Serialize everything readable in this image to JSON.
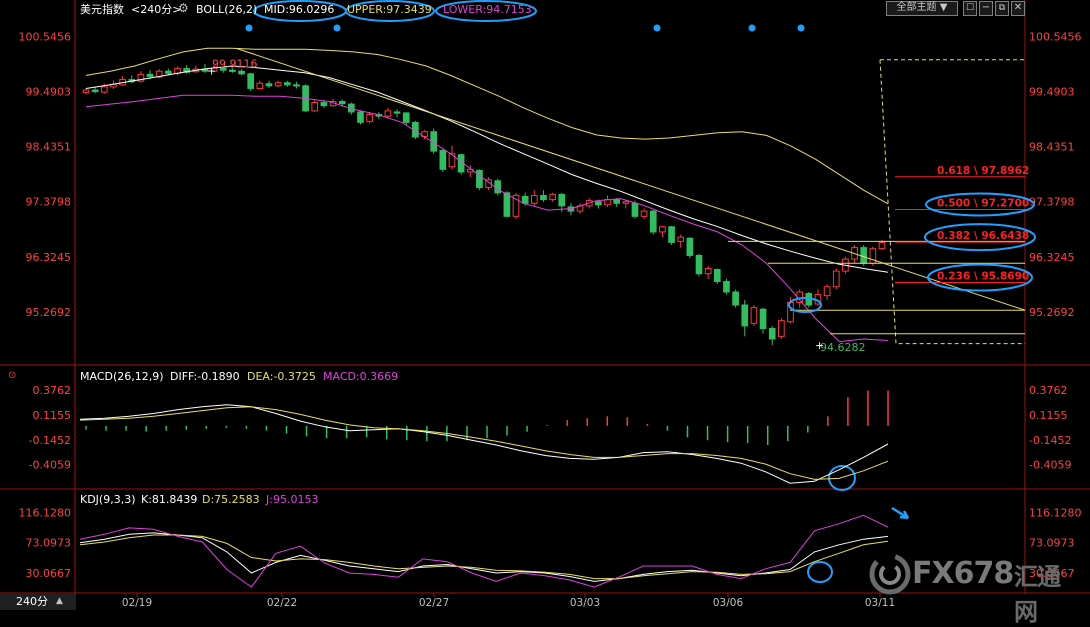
{
  "colors": {
    "up": "#ff3838",
    "down": "#2fbf5f",
    "mid": "#ffffff",
    "upper": "#e8e060",
    "lower": "#e040e0",
    "price_axis": "#ff4040",
    "fib": "#ff2020",
    "highlight": "#1ea0ff"
  },
  "header": {
    "symbol": "美元指数",
    "period": "<240分>",
    "indicator": "BOLL(26,2)",
    "mid": "MID:96.0296",
    "upper": "UPPER:97.3439",
    "lower": "LOWER:94.7153"
  },
  "toolbar": {
    "theme": "全部主题",
    "theme_arrow": "▼",
    "period_label": "240分",
    "period_arrow": "▲"
  },
  "chart_data": [
    {
      "type": "candlestick",
      "title": "美元指数 240分",
      "indicator": "BOLL(26,2)",
      "ylim": [
        94.5,
        100.9
      ],
      "price_ticks": [
        "100.5456",
        "99.4903",
        "98.4351",
        "97.3798",
        "96.3245",
        "95.2692"
      ],
      "date_ticks": [
        "02/19",
        "02/22",
        "02/27",
        "03/03",
        "03/06",
        "03/11"
      ],
      "high_label": "99.9116",
      "low_label": "94.6282",
      "fibonacci": [
        {
          "ratio": "0.618",
          "price": "97.8962"
        },
        {
          "ratio": "0.500",
          "price": "97.2700"
        },
        {
          "ratio": "0.382",
          "price": "96.6438"
        },
        {
          "ratio": "0.236",
          "price": "95.8690"
        }
      ],
      "series": [
        {
          "name": "MID",
          "values": [
            99.55,
            99.62,
            99.7,
            99.78,
            99.86,
            99.93,
            99.98,
            99.95,
            99.9,
            99.85,
            99.76,
            99.62,
            99.48,
            99.3,
            99.12,
            98.93,
            98.72,
            98.5,
            98.3,
            98.1,
            97.9,
            97.73,
            97.58,
            97.4,
            97.22,
            97.05,
            96.9,
            96.73,
            96.57,
            96.43,
            96.3,
            96.18,
            96.1,
            96.03
          ]
        },
        {
          "name": "UPPER",
          "values": [
            99.8,
            99.88,
            99.98,
            100.12,
            100.25,
            100.32,
            100.32,
            100.3,
            100.3,
            100.3,
            100.28,
            100.25,
            100.2,
            100.1,
            99.98,
            99.8,
            99.6,
            99.4,
            99.18,
            98.98,
            98.8,
            98.66,
            98.6,
            98.58,
            98.6,
            98.65,
            98.7,
            98.72,
            98.65,
            98.45,
            98.2,
            97.9,
            97.6,
            97.34
          ]
        },
        {
          "name": "LOWER",
          "values": [
            99.2,
            99.25,
            99.3,
            99.36,
            99.42,
            99.42,
            99.42,
            99.4,
            99.4,
            99.36,
            99.3,
            99.15,
            99.05,
            98.9,
            98.6,
            98.3,
            97.95,
            97.6,
            97.35,
            97.22,
            97.25,
            97.4,
            97.44,
            97.3,
            97.12,
            96.95,
            96.8,
            96.55,
            96.2,
            95.7,
            95.15,
            94.7,
            94.75,
            94.72
          ]
        }
      ],
      "candles": [
        [
          99.47,
          99.52,
          99.44,
          99.56
        ],
        [
          99.52,
          99.49,
          99.46,
          99.58
        ],
        [
          99.48,
          99.58,
          99.45,
          99.64
        ],
        [
          99.58,
          99.63,
          99.54,
          99.7
        ],
        [
          99.62,
          99.72,
          99.6,
          99.79
        ],
        [
          99.72,
          99.68,
          99.65,
          99.8
        ],
        [
          99.69,
          99.82,
          99.66,
          99.88
        ],
        [
          99.82,
          99.78,
          99.73,
          99.9
        ],
        [
          99.77,
          99.88,
          99.74,
          99.92
        ],
        [
          99.88,
          99.84,
          99.8,
          99.93
        ],
        [
          99.84,
          99.93,
          99.8,
          99.97
        ],
        [
          99.93,
          99.86,
          99.83,
          100.0
        ],
        [
          99.87,
          99.92,
          99.85,
          99.99
        ],
        [
          99.92,
          99.88,
          99.85,
          100.02
        ],
        [
          99.88,
          99.94,
          99.86,
          100.0
        ],
        [
          99.94,
          99.9,
          99.85,
          99.96
        ],
        [
          99.9,
          99.88,
          99.85,
          99.94
        ],
        [
          99.88,
          99.83,
          99.8,
          99.92
        ],
        [
          99.83,
          99.55,
          99.5,
          99.85
        ],
        [
          99.55,
          99.65,
          99.53,
          99.7
        ],
        [
          99.64,
          99.6,
          99.56,
          99.7
        ],
        [
          99.6,
          99.66,
          99.57,
          99.7
        ],
        [
          99.66,
          99.62,
          99.58,
          99.7
        ],
        [
          99.62,
          99.6,
          99.55,
          99.68
        ],
        [
          99.6,
          99.12,
          99.1,
          99.63
        ],
        [
          99.12,
          99.28,
          99.1,
          99.32
        ],
        [
          99.28,
          99.22,
          99.18,
          99.33
        ],
        [
          99.22,
          99.3,
          99.2,
          99.35
        ],
        [
          99.3,
          99.26,
          99.2,
          99.34
        ],
        [
          99.25,
          99.1,
          99.05,
          99.28
        ],
        [
          99.1,
          98.9,
          98.86,
          99.12
        ],
        [
          98.92,
          99.05,
          98.88,
          99.1
        ],
        [
          99.05,
          99.02,
          98.97,
          99.1
        ],
        [
          99.02,
          99.12,
          98.98,
          99.18
        ],
        [
          99.1,
          99.08,
          99.0,
          99.15
        ],
        [
          99.08,
          98.9,
          98.85,
          99.1
        ],
        [
          98.9,
          98.62,
          98.58,
          98.93
        ],
        [
          98.63,
          98.72,
          98.58,
          98.75
        ],
        [
          98.72,
          98.35,
          98.3,
          98.78
        ],
        [
          98.36,
          98.0,
          97.95,
          98.4
        ],
        [
          98.05,
          98.3,
          98.0,
          98.45
        ],
        [
          98.28,
          97.95,
          97.9,
          98.3
        ],
        [
          97.95,
          98.0,
          97.85,
          98.08
        ],
        [
          97.98,
          97.65,
          97.6,
          98.0
        ],
        [
          97.65,
          97.8,
          97.6,
          97.85
        ],
        [
          97.78,
          97.55,
          97.5,
          97.82
        ],
        [
          97.55,
          97.1,
          97.08,
          97.58
        ],
        [
          97.1,
          97.5,
          97.05,
          97.55
        ],
        [
          97.48,
          97.35,
          97.3,
          97.55
        ],
        [
          97.35,
          97.5,
          97.3,
          97.6
        ],
        [
          97.5,
          97.42,
          97.38,
          97.6
        ],
        [
          97.42,
          97.52,
          97.38,
          97.55
        ],
        [
          97.52,
          97.3,
          97.18,
          97.55
        ],
        [
          97.28,
          97.2,
          97.12,
          97.35
        ],
        [
          97.2,
          97.3,
          97.15,
          97.35
        ],
        [
          97.3,
          97.4,
          97.25,
          97.45
        ],
        [
          97.38,
          97.32,
          97.25,
          97.42
        ],
        [
          97.32,
          97.42,
          97.28,
          97.5
        ],
        [
          97.42,
          97.35,
          97.28,
          97.45
        ],
        [
          97.35,
          97.38,
          97.25,
          97.42
        ],
        [
          97.35,
          97.1,
          97.06,
          97.4
        ],
        [
          97.1,
          97.2,
          97.05,
          97.25
        ],
        [
          97.2,
          96.8,
          96.75,
          97.22
        ],
        [
          96.8,
          96.9,
          96.7,
          96.92
        ],
        [
          96.9,
          96.6,
          96.55,
          96.92
        ],
        [
          96.62,
          96.7,
          96.5,
          96.75
        ],
        [
          96.68,
          96.35,
          96.3,
          96.7
        ],
        [
          96.35,
          96.0,
          95.95,
          96.38
        ],
        [
          96.0,
          96.1,
          95.9,
          96.15
        ],
        [
          96.08,
          95.85,
          95.8,
          96.1
        ],
        [
          95.85,
          95.65,
          95.6,
          95.9
        ],
        [
          95.65,
          95.4,
          95.35,
          95.7
        ],
        [
          95.4,
          95.0,
          94.8,
          95.5
        ],
        [
          95.05,
          95.35,
          95.0,
          95.4
        ],
        [
          95.32,
          94.95,
          94.85,
          95.35
        ],
        [
          94.95,
          94.75,
          94.63,
          95.0
        ],
        [
          94.8,
          95.1,
          94.75,
          95.15
        ],
        [
          95.08,
          95.45,
          95.05,
          95.55
        ],
        [
          95.45,
          95.65,
          95.35,
          95.7
        ],
        [
          95.62,
          95.4,
          95.35,
          95.65
        ],
        [
          95.42,
          95.6,
          95.38,
          95.7
        ],
        [
          95.58,
          95.75,
          95.5,
          95.8
        ],
        [
          95.75,
          96.05,
          95.7,
          96.1
        ],
        [
          96.05,
          96.28,
          96.0,
          96.32
        ],
        [
          96.28,
          96.5,
          96.2,
          96.55
        ],
        [
          96.5,
          96.2,
          96.15,
          96.55
        ],
        [
          96.2,
          96.48,
          96.15,
          96.52
        ],
        [
          96.48,
          96.6,
          96.45,
          96.65
        ]
      ]
    },
    {
      "type": "bar",
      "title": "MACD(26,12,9)",
      "diff": "DIFF:-0.1890",
      "dea": "DEA:-0.3725",
      "macd": "MACD:0.3669",
      "ylim": [
        -0.65,
        0.48
      ],
      "ticks": [
        "0.3762",
        "0.1155",
        "-0.1452",
        "-0.4059"
      ],
      "series": [
        {
          "name": "DIFF",
          "values": [
            0.07,
            0.08,
            0.1,
            0.13,
            0.17,
            0.2,
            0.22,
            0.2,
            0.13,
            0.05,
            -0.01,
            -0.05,
            -0.04,
            -0.03,
            -0.06,
            -0.1,
            -0.15,
            -0.2,
            -0.26,
            -0.31,
            -0.34,
            -0.35,
            -0.33,
            -0.28,
            -0.27,
            -0.3,
            -0.34,
            -0.39,
            -0.48,
            -0.6,
            -0.58,
            -0.46,
            -0.33,
            -0.19
          ]
        },
        {
          "name": "DEA",
          "values": [
            0.06,
            0.07,
            0.08,
            0.1,
            0.13,
            0.16,
            0.19,
            0.2,
            0.17,
            0.12,
            0.06,
            0.01,
            -0.02,
            -0.03,
            -0.05,
            -0.08,
            -0.12,
            -0.16,
            -0.21,
            -0.26,
            -0.3,
            -0.33,
            -0.33,
            -0.31,
            -0.29,
            -0.29,
            -0.31,
            -0.34,
            -0.4,
            -0.5,
            -0.56,
            -0.55,
            -0.47,
            -0.37
          ]
        },
        {
          "name": "MACD",
          "values": [
            -0.04,
            -0.05,
            -0.05,
            -0.06,
            -0.05,
            -0.04,
            -0.03,
            -0.02,
            -0.03,
            -0.05,
            -0.08,
            -0.11,
            -0.13,
            -0.13,
            -0.12,
            -0.14,
            -0.15,
            -0.16,
            -0.16,
            -0.15,
            -0.13,
            -0.1,
            -0.06,
            0.01,
            0.06,
            0.08,
            0.1,
            0.09,
            0.02,
            -0.05,
            -0.12,
            -0.15,
            -0.17,
            -0.18,
            -0.2,
            -0.16,
            -0.07,
            0.1,
            0.3,
            0.37,
            0.37
          ]
        }
      ]
    },
    {
      "type": "line",
      "title": "KDJ(9,3,3)",
      "k": "K:81.8439",
      "d": "D:75.2583",
      "j": "J:95.0153",
      "ylim": [
        3,
        128
      ],
      "ticks": [
        "116.1280",
        "73.0973",
        "30.0667"
      ],
      "series": [
        {
          "name": "K",
          "values": [
            73,
            78,
            85,
            87,
            84,
            80,
            60,
            30,
            45,
            55,
            48,
            40,
            36,
            32,
            40,
            42,
            36,
            30,
            32,
            30,
            25,
            18,
            22,
            28,
            32,
            34,
            30,
            26,
            30,
            35,
            60,
            70,
            78,
            82
          ]
        },
        {
          "name": "D",
          "values": [
            70,
            74,
            80,
            84,
            84,
            82,
            72,
            52,
            47,
            50,
            49,
            45,
            40,
            36,
            38,
            40,
            38,
            34,
            33,
            31,
            28,
            22,
            22,
            26,
            29,
            32,
            31,
            28,
            29,
            32,
            46,
            58,
            70,
            75
          ]
        },
        {
          "name": "J",
          "values": [
            78,
            85,
            94,
            92,
            82,
            74,
            35,
            10,
            58,
            68,
            44,
            30,
            28,
            24,
            50,
            46,
            30,
            18,
            30,
            26,
            20,
            10,
            24,
            40,
            40,
            40,
            28,
            22,
            36,
            45,
            90,
            100,
            112,
            95
          ]
        }
      ]
    }
  ],
  "watermark": {
    "brand": "FX678",
    "name": "汇通网"
  }
}
